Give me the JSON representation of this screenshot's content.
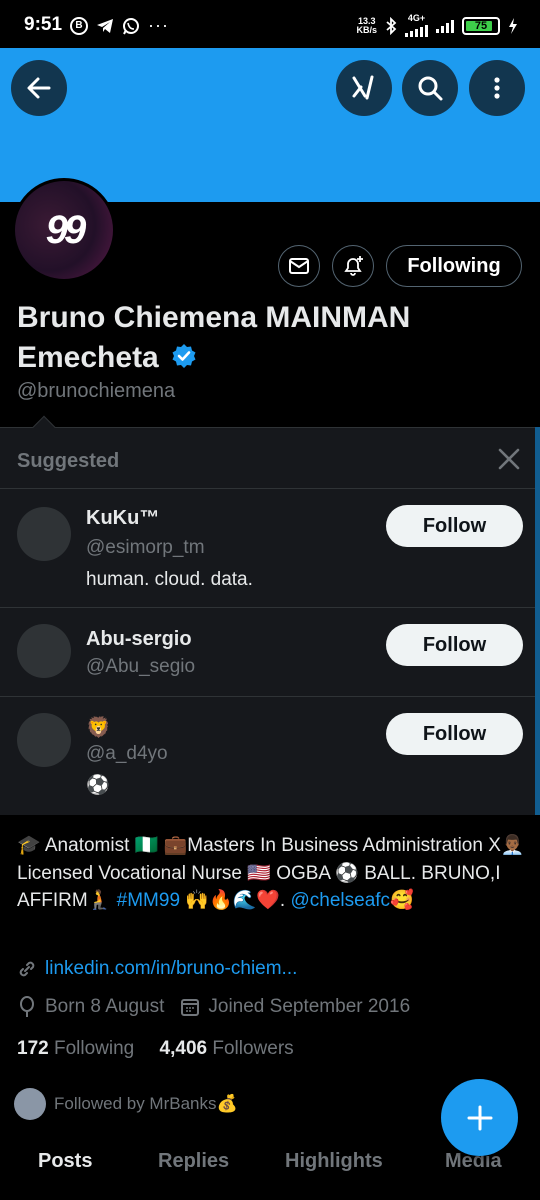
{
  "status_bar": {
    "time": "9:51",
    "speed_value": "13.3",
    "speed_unit": "KB/s",
    "network": "4G+",
    "battery": "75"
  },
  "profile": {
    "avatar_text": "99",
    "following_button": "Following",
    "display_name": "Bruno Chiemena MAINMAN Emecheta",
    "handle": "@brunochiemena",
    "bio_parts": {
      "text1": "🎓 Anatomist 🇳🇬 💼Masters In Business Administration X👨🏾‍💼Licensed Vocational Nurse 🇺🇸 OGBA ⚽ BALL. BRUNO,I AFFIRM🧎 ",
      "hashtag": "#MM99",
      "text2": " 🙌🔥🌊❤️. ",
      "mention": "@chelseafc",
      "text3": "🥰"
    },
    "link": "linkedin.com/in/bruno-chiem...",
    "born": "Born 8 August",
    "joined": "Joined September 2016",
    "following_count": "172",
    "following_label": "Following",
    "followers_count": "4,406",
    "followers_label": "Followers",
    "followed_by": "Followed by MrBanks💰"
  },
  "suggested": {
    "title": "Suggested",
    "items": [
      {
        "name": "KuKu™",
        "handle": "@esimorp_tm",
        "bio": "human. cloud. data.",
        "button": "Follow"
      },
      {
        "name": "Abu-sergio",
        "handle": "@Abu_segio",
        "bio": "",
        "button": "Follow"
      },
      {
        "name": "🦁",
        "handle": "@a_d4yo",
        "bio": "⚽",
        "button": "Follow"
      }
    ]
  },
  "tabs": [
    "Posts",
    "Replies",
    "Highlights",
    "Media"
  ],
  "colors": {
    "accent": "#1d9bf0",
    "background": "#000000",
    "panel": "#16181c",
    "muted_text": "#71767b"
  }
}
